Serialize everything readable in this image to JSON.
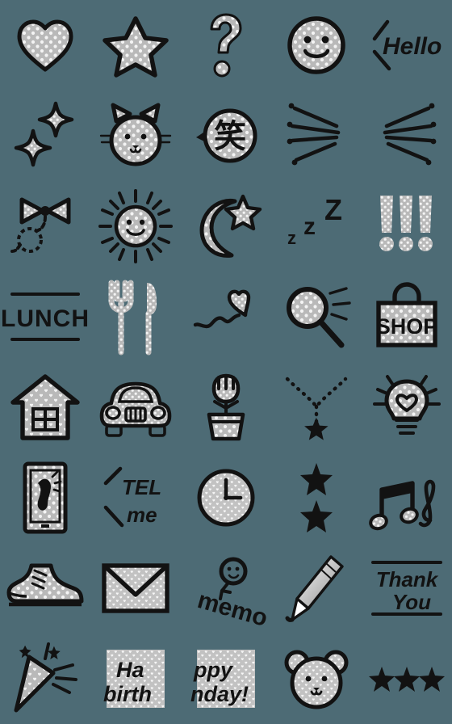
{
  "sheet": {
    "title": "Monochrome Polka-Dot Emoji Sticker Sheet",
    "background_color": "#4d6b75",
    "ink_color": "#121212",
    "fill_gray": "#b9b9b9",
    "dot_color": "#f2f2f2",
    "columns": 5,
    "rows": 8,
    "cell_size": 112,
    "count": 40
  },
  "stickers": [
    {
      "id": 1,
      "row": 1,
      "col": 1,
      "name": "heart",
      "label": "Polka-dot heart",
      "text": "",
      "pattern": "dots"
    },
    {
      "id": 2,
      "row": 1,
      "col": 2,
      "name": "star",
      "label": "Polka-dot star",
      "text": "",
      "pattern": "dots"
    },
    {
      "id": 3,
      "row": 1,
      "col": 3,
      "name": "question-mark",
      "label": "Polka-dot question mark",
      "text": "?",
      "pattern": "dots"
    },
    {
      "id": 4,
      "row": 1,
      "col": 4,
      "name": "smiley-face",
      "label": "Smiling face",
      "text": "",
      "pattern": "dots"
    },
    {
      "id": 5,
      "row": 1,
      "col": 5,
      "name": "hello-text",
      "label": "Hello in brackets",
      "text": "Hello",
      "pattern": "none"
    },
    {
      "id": 6,
      "row": 2,
      "col": 1,
      "name": "sparkles",
      "label": "Twinkling sparkles",
      "text": "",
      "pattern": "dots"
    },
    {
      "id": 7,
      "row": 2,
      "col": 2,
      "name": "cat-face",
      "label": "Cat face",
      "text": "",
      "pattern": "dots"
    },
    {
      "id": 8,
      "row": 2,
      "col": 3,
      "name": "laugh-bubble",
      "label": "Speech bubble with kanji",
      "text": "笑",
      "pattern": "dots"
    },
    {
      "id": 9,
      "row": 2,
      "col": 4,
      "name": "focus-lines-right",
      "label": "Emphasis lines pointing right",
      "text": "",
      "pattern": "none"
    },
    {
      "id": 10,
      "row": 2,
      "col": 5,
      "name": "focus-lines-left",
      "label": "Emphasis lines pointing left",
      "text": "",
      "pattern": "none"
    },
    {
      "id": 11,
      "row": 3,
      "col": 1,
      "name": "ribbon-bow",
      "label": "Ribbon bow with curled string",
      "text": "",
      "pattern": "dots"
    },
    {
      "id": 12,
      "row": 3,
      "col": 2,
      "name": "sun-face",
      "label": "Smiling sun",
      "text": "",
      "pattern": "dots"
    },
    {
      "id": 13,
      "row": 3,
      "col": 3,
      "name": "moon-star",
      "label": "Crescent moon and star",
      "text": "",
      "pattern": "dots"
    },
    {
      "id": 14,
      "row": 3,
      "col": 4,
      "name": "sleeping-zzz",
      "label": "Sleeping z z Z",
      "text": "zzZ",
      "pattern": "none"
    },
    {
      "id": 15,
      "row": 3,
      "col": 5,
      "name": "exclamation-trio",
      "label": "Three exclamation marks",
      "text": "!!!",
      "pattern": "dots"
    },
    {
      "id": 16,
      "row": 4,
      "col": 1,
      "name": "lunch-text",
      "label": "LUNCH banner",
      "text": "LUNCH",
      "pattern": "none"
    },
    {
      "id": 17,
      "row": 4,
      "col": 2,
      "name": "fork-knife",
      "label": "Fork and knife",
      "text": "",
      "pattern": "dots"
    },
    {
      "id": 18,
      "row": 4,
      "col": 3,
      "name": "heart-balloon",
      "label": "Heart on a squiggly string",
      "text": "",
      "pattern": "dots"
    },
    {
      "id": 19,
      "row": 4,
      "col": 4,
      "name": "magnifier",
      "label": "Magnifying glass",
      "text": "",
      "pattern": "dots"
    },
    {
      "id": 20,
      "row": 4,
      "col": 5,
      "name": "shop-bag",
      "label": "Shopping bag",
      "text": "SHOP",
      "pattern": "dots"
    },
    {
      "id": 21,
      "row": 5,
      "col": 1,
      "name": "house",
      "label": "House",
      "text": "",
      "pattern": "hearts"
    },
    {
      "id": 22,
      "row": 5,
      "col": 2,
      "name": "car",
      "label": "Car front view",
      "text": "",
      "pattern": "dots"
    },
    {
      "id": 23,
      "row": 5,
      "col": 3,
      "name": "potted-tulip",
      "label": "Tulip in a flower pot",
      "text": "",
      "pattern": "dots"
    },
    {
      "id": 24,
      "row": 5,
      "col": 4,
      "name": "star-necklace",
      "label": "Beaded necklace with star",
      "text": "",
      "pattern": "none"
    },
    {
      "id": 25,
      "row": 5,
      "col": 5,
      "name": "idea-bulb",
      "label": "Light bulb with heart filament",
      "text": "",
      "pattern": "dots"
    },
    {
      "id": 26,
      "row": 6,
      "col": 1,
      "name": "phone-ringing",
      "label": "Smartphone ringing",
      "text": "",
      "pattern": "dots"
    },
    {
      "id": 27,
      "row": 6,
      "col": 2,
      "name": "tel-me-text",
      "label": "TEL me in brackets",
      "text": "TEL me",
      "pattern": "none"
    },
    {
      "id": 28,
      "row": 6,
      "col": 3,
      "name": "clock",
      "label": "Wall clock",
      "text": "",
      "pattern": "hearts"
    },
    {
      "id": 29,
      "row": 6,
      "col": 4,
      "name": "two-stars",
      "label": "Two stacked stars",
      "text": "",
      "pattern": "none"
    },
    {
      "id": 30,
      "row": 6,
      "col": 5,
      "name": "music-notes",
      "label": "Music notes and treble clef",
      "text": "",
      "pattern": "dots"
    },
    {
      "id": 31,
      "row": 7,
      "col": 1,
      "name": "sneaker",
      "label": "High-top sneaker",
      "text": "",
      "pattern": "dots"
    },
    {
      "id": 32,
      "row": 7,
      "col": 2,
      "name": "envelope",
      "label": "Sealed envelope",
      "text": "",
      "pattern": "hearts"
    },
    {
      "id": 33,
      "row": 7,
      "col": 3,
      "name": "memo-text",
      "label": "Memo with balloon smiley",
      "text": "memo",
      "pattern": "none"
    },
    {
      "id": 34,
      "row": 7,
      "col": 4,
      "name": "pen",
      "label": "Ballpoint pen",
      "text": "",
      "pattern": "none"
    },
    {
      "id": 35,
      "row": 7,
      "col": 5,
      "name": "thank-you-text",
      "label": "Thank You banner",
      "text": "Thank You",
      "pattern": "none"
    },
    {
      "id": 36,
      "row": 8,
      "col": 1,
      "name": "party-popper",
      "label": "Party popper",
      "text": "",
      "pattern": "hearts"
    },
    {
      "id": 37,
      "row": 8,
      "col": 2,
      "name": "birthday-left",
      "label": "Happy birthday banner left half",
      "text": "Happy birthday!",
      "pattern": "hearts"
    },
    {
      "id": 38,
      "row": 8,
      "col": 3,
      "name": "birthday-right",
      "label": "Happy birthday banner right half",
      "text": "Happy birthday!",
      "pattern": "hearts"
    },
    {
      "id": 39,
      "row": 8,
      "col": 4,
      "name": "bear-face",
      "label": "Bear face",
      "text": "",
      "pattern": "hearts"
    },
    {
      "id": 40,
      "row": 8,
      "col": 5,
      "name": "three-stars",
      "label": "Three stars in a row",
      "text": "",
      "pattern": "none"
    }
  ],
  "texts": {
    "hello": "Hello",
    "laugh_kanji": "笑",
    "z_small": "z",
    "z_mid": "z",
    "z_big": "Z",
    "lunch": "LUNCH",
    "shop": "SHOP",
    "tel": "TEL",
    "me": "me",
    "memo": "memo",
    "thank": "Thank",
    "you": "You",
    "bday_a": "Ha",
    "bday_b": "birth",
    "bday_c": "ppy",
    "bday_d": "nday!"
  }
}
